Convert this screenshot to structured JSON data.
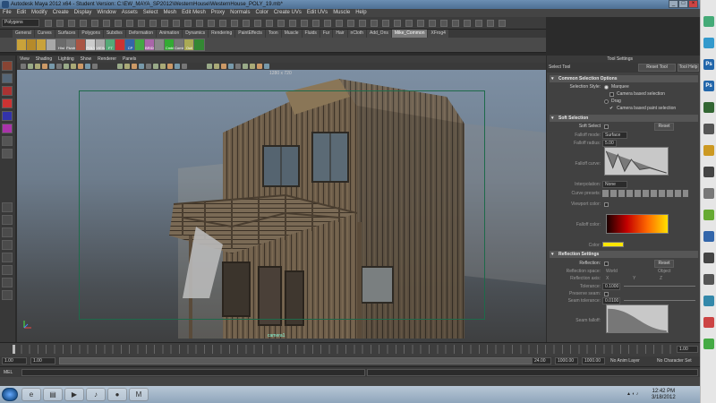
{
  "window": {
    "title": "Autodesk Maya 2012 x64 - Student Version: C:\\EW_MAYA_SP2012\\WesternHouse\\WesternHouse_POLY_19.mb*",
    "controls": [
      "_",
      "□",
      "×"
    ]
  },
  "menubar": [
    "File",
    "Edit",
    "Modify",
    "Create",
    "Display",
    "Window",
    "Assets",
    "Select",
    "Mesh",
    "Edit Mesh",
    "Proxy",
    "Normals",
    "Color",
    "Create UVs",
    "Edit UVs",
    "Muscle",
    "Help"
  ],
  "status_line": {
    "mode": "Polygons"
  },
  "shelf": {
    "tabs": [
      "General",
      "Curves",
      "Surfaces",
      "Polygons",
      "Subdivs",
      "Deformation",
      "Animation",
      "Dynamics",
      "Rendering",
      "PaintEffects",
      "Toon",
      "Muscle",
      "Fluids",
      "Fur",
      "Hair",
      "nCloth",
      "Add_Ons",
      "Mike_Common",
      "XFrog4"
    ],
    "active_tab": "Mike_Common",
    "items": [
      "",
      "",
      "",
      "",
      "Hist",
      "Pivots",
      "",
      "POLY",
      "VIEW",
      "FT",
      "",
      "CP",
      "",
      "BRIDG",
      "",
      "Cmbl",
      "Comb",
      "Outl",
      ""
    ]
  },
  "viewport": {
    "menu": [
      "View",
      "Shading",
      "Lighting",
      "Show",
      "Renderer",
      "Panels"
    ],
    "resolution": "1280 x 720",
    "camera": "camera1"
  },
  "attribute_editor": {
    "title": "Tool Settings",
    "tool_name": "Select Tool",
    "reset_button": "Reset Tool",
    "help_button": "Tool Help",
    "common": {
      "header": "Common Selection Options",
      "selection_style_label": "Selection Style:",
      "marquee": "Marquee",
      "camera_based": "Camera based selection",
      "drag": "Drag",
      "camera_based_paint": "Camera based paint selection"
    },
    "soft": {
      "header": "Soft Selection",
      "soft_select": "Soft Select",
      "reset": "Reset",
      "falloff_mode": "Falloff mode:",
      "falloff_mode_value": "Surface",
      "falloff_radius": "Falloff radius:",
      "falloff_radius_value": "5.00",
      "falloff_curve": "Falloff curve:",
      "interpolation": "Interpolation:",
      "interpolation_value": "None",
      "curve_presets": "Curve presets:",
      "viewport_color": "Viewport color:",
      "falloff_color": "Falloff color:",
      "color": "Color:",
      "color_hex": "#ffe600"
    },
    "reflection": {
      "header": "Reflection Settings",
      "reflection": "Reflection:",
      "reset": "Reset",
      "space": "Reflection space:",
      "world": "World",
      "object": "Object",
      "axis": "Reflection axis:",
      "x": "X",
      "y": "Y",
      "z": "Z",
      "tolerance": "Tolerance:",
      "tolerance_value": "0.1000",
      "preserve_seam": "Preserve seam:",
      "seam_tolerance": "Seam tolerance:",
      "seam_value": "0.0100",
      "seam_falloff": "Seam falloff:"
    }
  },
  "timeline": {
    "ticks": [
      "1",
      "",
      "",
      "",
      "",
      "",
      "",
      "",
      "",
      "",
      "",
      "",
      "",
      "",
      "",
      "",
      "",
      "",
      "",
      "",
      "",
      "",
      "",
      "",
      "24"
    ],
    "current": "1.00",
    "range_start": "1.00",
    "range_start2": "1.00",
    "range_end": "24.00",
    "end1": "1000.00",
    "end2": "1000.00",
    "anim_layer": "No Anim Layer",
    "char_set": "No Character Set"
  },
  "mel": {
    "label": "MEL"
  },
  "help": {
    "text": ""
  },
  "taskbar": {
    "time": "12:42 PM",
    "date": "3/18/2012",
    "apps": [
      "start",
      "ie",
      "explorer",
      "media",
      "winamp",
      "firefox",
      "maya"
    ]
  },
  "dock": {
    "icons": [
      "mail-icon",
      "globe-icon",
      "ps-icon",
      "ps-icon",
      "ai-icon",
      "maya-icon",
      "folder-icon",
      "text-icon",
      "alien-icon",
      "flower-icon",
      "maya-icon",
      "text-icon",
      "music-icon",
      "monitor-icon",
      "person-icon",
      "cpu-icon"
    ],
    "labels": [
      "",
      "",
      "Ps",
      "Ps",
      "",
      "",
      "",
      "",
      "",
      "",
      "",
      "",
      "",
      "",
      "",
      ""
    ]
  }
}
